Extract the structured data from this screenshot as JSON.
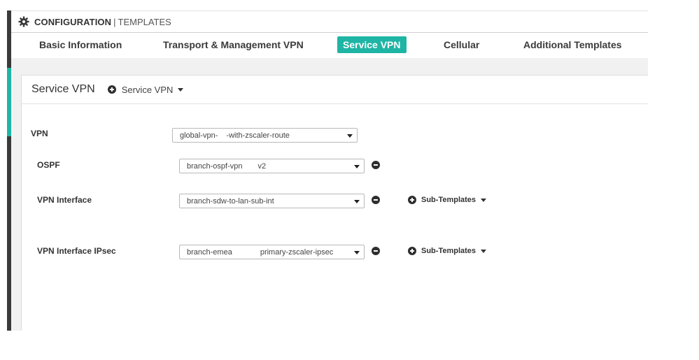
{
  "header": {
    "title_strong": "CONFIGURATION",
    "separator": "|",
    "title_light": "TEMPLATES"
  },
  "tabs": [
    {
      "label": "Basic Information",
      "active": false
    },
    {
      "label": "Transport & Management VPN",
      "active": false
    },
    {
      "label": "Service VPN",
      "active": true
    },
    {
      "label": "Cellular",
      "active": false
    },
    {
      "label": "Additional Templates",
      "active": false
    }
  ],
  "panel": {
    "title": "Service VPN",
    "add_label": "Service VPN"
  },
  "rows": {
    "vpn": {
      "label": "VPN",
      "value_a": "global-vpn-",
      "value_b": "-with-zscaler-route"
    },
    "ospf": {
      "label": "OSPF",
      "value_a": "branch-ospf-vpn",
      "value_b": "v2"
    },
    "vpn_interface": {
      "label": "VPN Interface",
      "value_a": "branch-sdw-to-lan-sub-int",
      "value_b": "",
      "sub_templates_label": "Sub-Templates"
    },
    "vpn_interface_ipsec": {
      "label": "VPN Interface IPsec",
      "value_a": "branch-emea",
      "value_b": "primary-zscaler-ipsec",
      "sub_templates_label": "Sub-Templates"
    }
  },
  "colors": {
    "accent": "#1fb5a5",
    "rail": "#3a3a3a"
  },
  "icons": {
    "header": "gear-icon",
    "add": "plus-circle-icon",
    "remove": "minus-circle-icon",
    "dropdown": "caret-down-icon"
  }
}
